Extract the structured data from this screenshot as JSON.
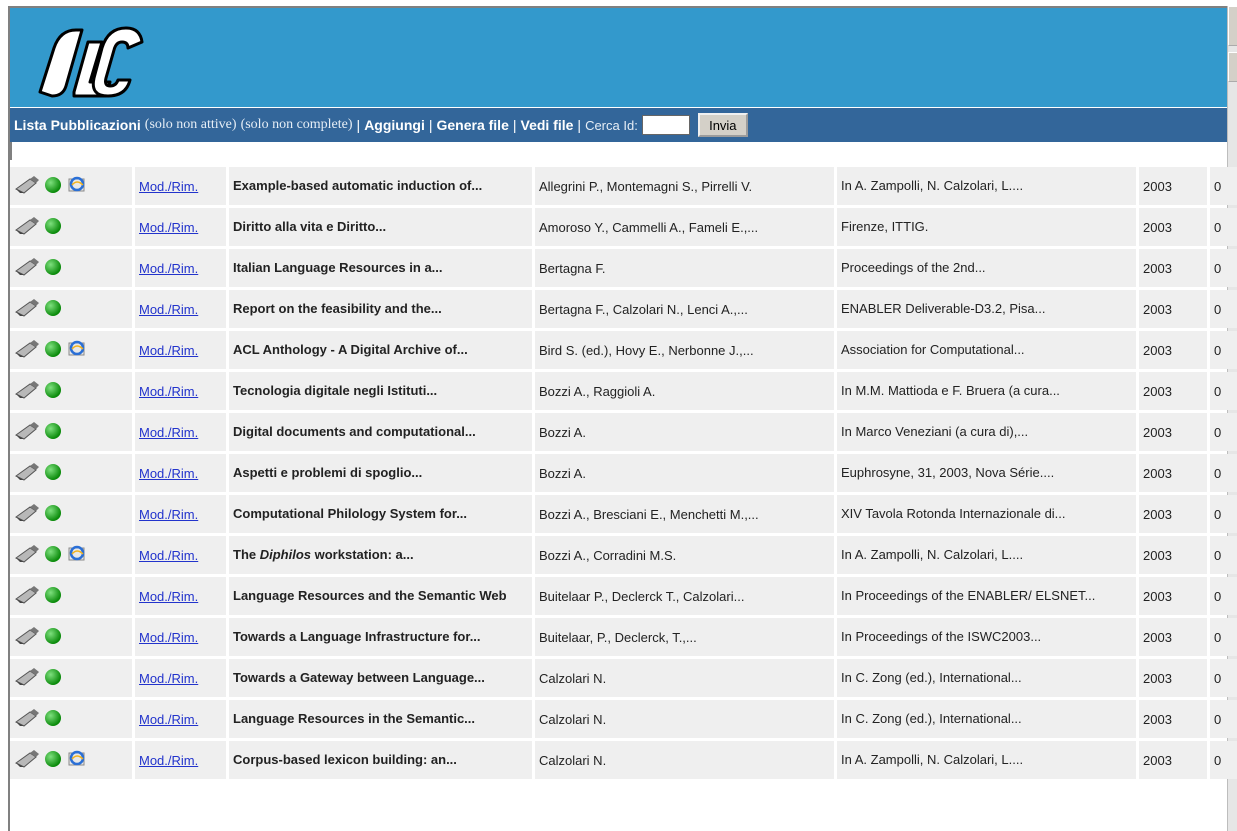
{
  "navbar": {
    "lista": "Lista Pubblicazioni",
    "solo_non_attive": "(solo non attive)",
    "solo_non_complete": "(solo non complete)",
    "aggiungi": "Aggiungi",
    "genera_file": "Genera file",
    "vedi_file": "Vedi file",
    "cerca_label": "Cerca Id:",
    "cerca_value": "",
    "invia": "Invia",
    "separator": "|"
  },
  "colors": {
    "banner": "#3399cc",
    "navbar": "#33669a",
    "row": "#efefef",
    "link": "#2233cc"
  },
  "rows": [
    {
      "mod": "Mod./Rim.",
      "title": "Example-based automatic induction of...",
      "authors": "Allegrini P., Montemagni S., Pirrelli V.",
      "source": "In A. Zampolli, N. Calzolari, L....",
      "year": "2003",
      "count": "0",
      "pdf": true
    },
    {
      "mod": "Mod./Rim.",
      "title": "Diritto alla vita e Diritto...",
      "authors": "Amoroso Y., Cammelli A., Fameli E.,...",
      "source": "Firenze, ITTIG.",
      "year": "2003",
      "count": "0",
      "pdf": false
    },
    {
      "mod": "Mod./Rim.",
      "title": "Italian Language Resources in a...",
      "authors": "Bertagna F.",
      "source": "Proceedings of the 2nd...",
      "year": "2003",
      "count": "0",
      "pdf": false
    },
    {
      "mod": "Mod./Rim.",
      "title": "Report on the feasibility and the...",
      "authors": "Bertagna F., Calzolari N., Lenci A.,...",
      "source": "ENABLER Deliverable-D3.2, Pisa...",
      "year": "2003",
      "count": "0",
      "pdf": false
    },
    {
      "mod": "Mod./Rim.",
      "title": "ACL Anthology - A Digital Archive of...",
      "authors": "Bird S. (ed.), Hovy E., Nerbonne J.,...",
      "source": "Association for Computational...",
      "year": "2003",
      "count": "0",
      "pdf": true
    },
    {
      "mod": "Mod./Rim.",
      "title": "Tecnologia digitale negli Istituti...",
      "authors": "Bozzi A., Raggioli A.",
      "source": "In M.M. Mattioda e F. Bruera (a cura...",
      "year": "2003",
      "count": "0",
      "pdf": false
    },
    {
      "mod": "Mod./Rim.",
      "title": "Digital documents and computational...",
      "authors": "Bozzi A.",
      "source": "In Marco Veneziani (a cura di),...",
      "year": "2003",
      "count": "0",
      "pdf": false
    },
    {
      "mod": "Mod./Rim.",
      "title": "Aspetti e problemi di spoglio...",
      "authors": "Bozzi A.",
      "source": "Euphrosyne, 31, 2003, Nova Série....",
      "year": "2003",
      "count": "0",
      "pdf": false
    },
    {
      "mod": "Mod./Rim.",
      "title": "Computational Philology System for...",
      "authors": "Bozzi A., Bresciani E., Menchetti M.,...",
      "source": "XIV Tavola Rotonda Internazionale di...",
      "year": "2003",
      "count": "0",
      "pdf": false
    },
    {
      "mod": "Mod./Rim.",
      "title_pre": "The ",
      "title_em": "Diphilos",
      "title_post": " workstation: a...",
      "authors": "Bozzi A., Corradini M.S.",
      "source": "In A. Zampolli, N. Calzolari, L....",
      "year": "2003",
      "count": "0",
      "pdf": true
    },
    {
      "mod": "Mod./Rim.",
      "title": "Language Resources and the Semantic Web",
      "authors": "Buitelaar P., Declerck T., Calzolari...",
      "source": "In Proceedings of the ENABLER/ ELSNET...",
      "year": "2003",
      "count": "0",
      "pdf": false
    },
    {
      "mod": "Mod./Rim.",
      "title": "Towards a Language Infrastructure for...",
      "authors": "Buitelaar, P., Declerck, T.,...",
      "source": "In Proceedings of the ISWC2003...",
      "year": "2003",
      "count": "0",
      "pdf": false
    },
    {
      "mod": "Mod./Rim.",
      "title": "Towards a Gateway between Language...",
      "authors": "Calzolari N.",
      "source": "In C. Zong (ed.), International...",
      "year": "2003",
      "count": "0",
      "pdf": false
    },
    {
      "mod": "Mod./Rim.",
      "title": "Language Resources in the Semantic...",
      "authors": "Calzolari N.",
      "source": "In C. Zong (ed.), International...",
      "year": "2003",
      "count": "0",
      "pdf": false
    },
    {
      "mod": "Mod./Rim.",
      "title": "Corpus-based lexicon building: an...",
      "authors": "Calzolari N.",
      "source": "In A. Zampolli, N. Calzolari, L....",
      "year": "2003",
      "count": "0",
      "pdf": true
    }
  ]
}
